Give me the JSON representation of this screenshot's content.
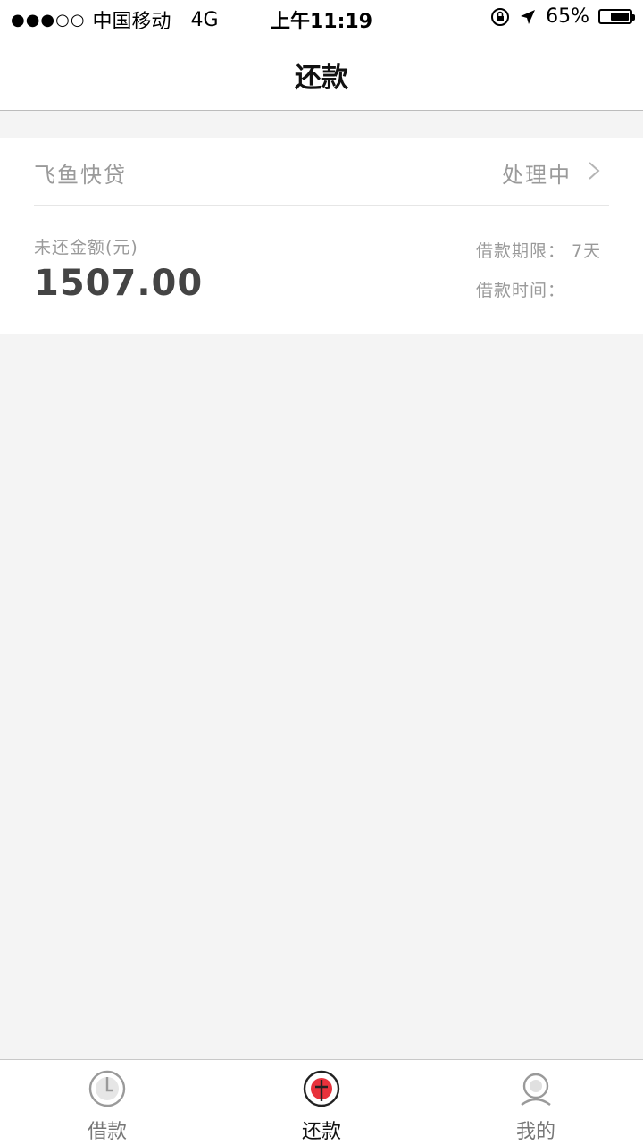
{
  "status_bar": {
    "signal": "●●●○○",
    "carrier": "中国移动",
    "network": "4G",
    "time": "上午11:19",
    "battery_percent": "65%",
    "battery_level": 0.65
  },
  "header": {
    "title": "还款"
  },
  "loan_card": {
    "lender": "飞鱼快贷",
    "status": "处理中",
    "amount_label": "未还金额(元)",
    "amount": "1507.00",
    "term": "借款期限：  7天",
    "time_label": "借款时间："
  },
  "tabbar": {
    "items": [
      {
        "label": "借款",
        "icon": "borrow-icon"
      },
      {
        "label": "还款",
        "icon": "repay-icon"
      },
      {
        "label": "我的",
        "icon": "profile-icon"
      }
    ],
    "active_index": 1,
    "accent": "#e8323c"
  }
}
